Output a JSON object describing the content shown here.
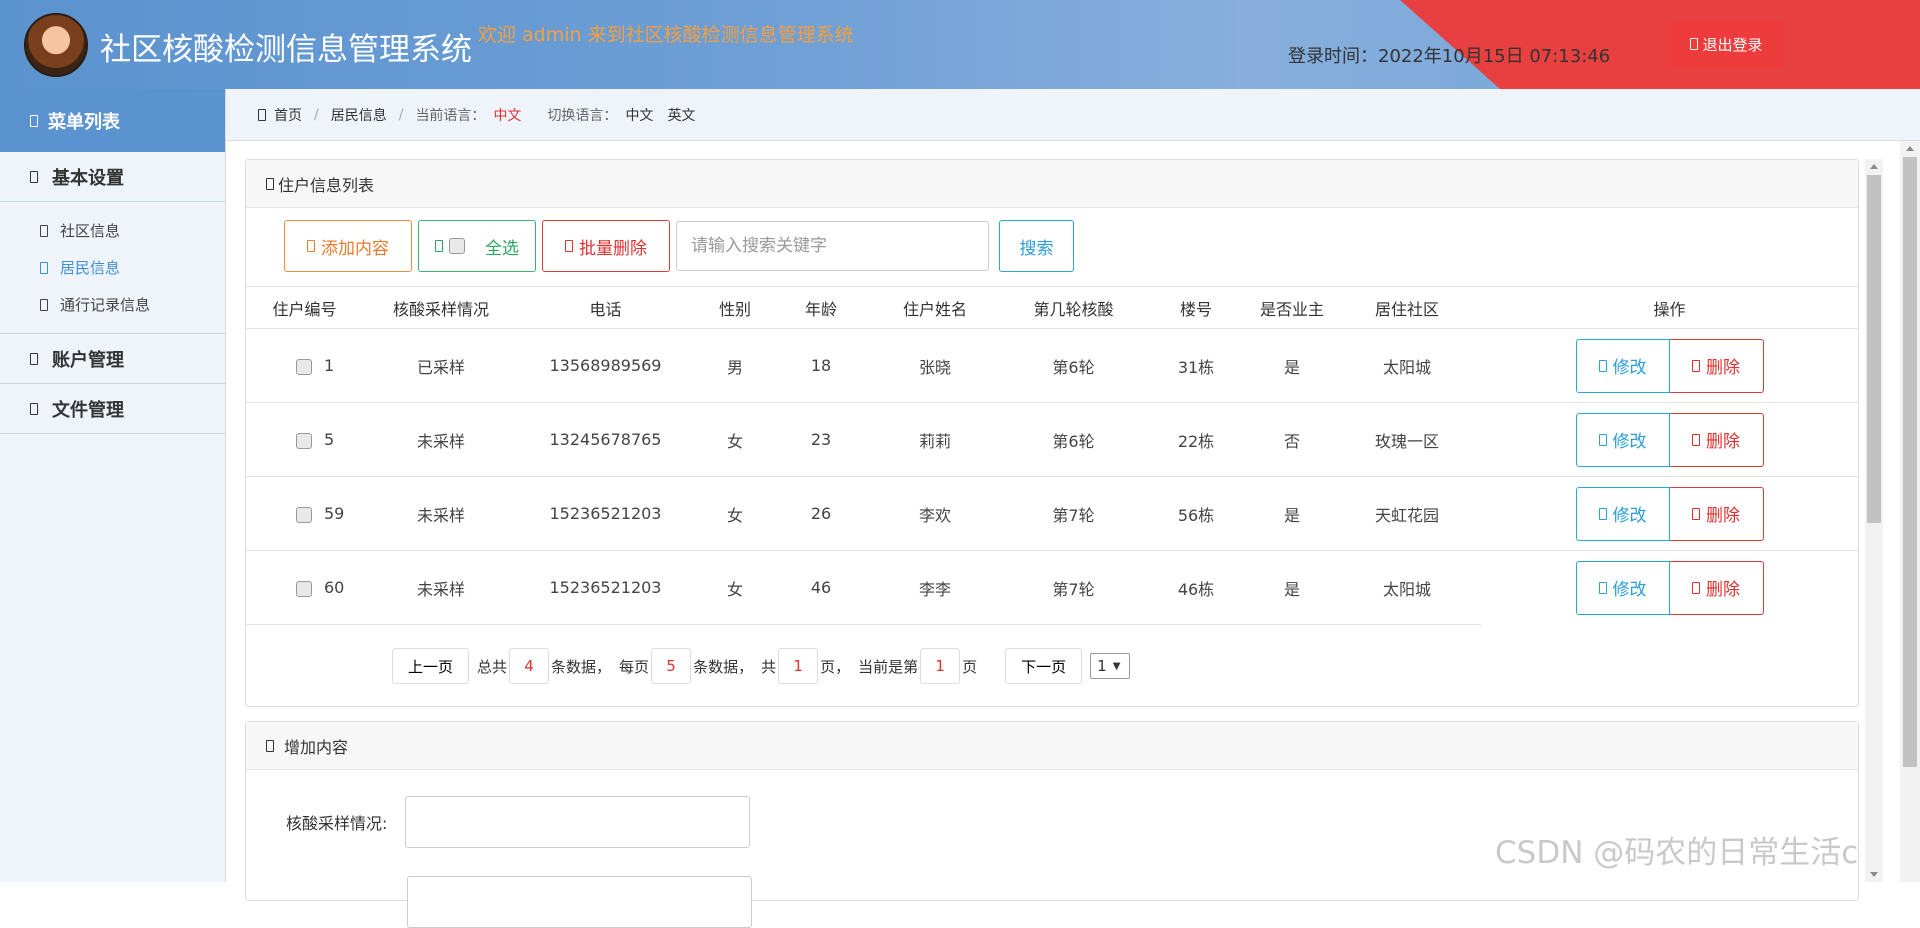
{
  "header": {
    "title": "社区核酸检测信息管理系统",
    "welcome": "欢迎 admin 来到社区核酸检测信息管理系统",
    "login_time_label": "登录时间：",
    "login_time": "2022年10月15日 07:13:46",
    "logout_label": "退出登录"
  },
  "sidebar": {
    "menu_title": "菜单列表",
    "groups": [
      {
        "label": "基本设置",
        "items": [
          {
            "label": "社区信息"
          },
          {
            "label": "居民信息"
          },
          {
            "label": "通行记录信息"
          }
        ]
      },
      {
        "label": "账户管理"
      },
      {
        "label": "文件管理"
      }
    ],
    "active_item": "居民信息"
  },
  "breadcrumb": {
    "home": "首页",
    "current": "居民信息",
    "lang_label": "当前语言：",
    "lang_value": "中文",
    "switch_label": "切换语言：",
    "lang_zh": "中文",
    "lang_en": "英文"
  },
  "list_panel": {
    "title": "住户信息列表",
    "add_label": "添加内容",
    "select_all_label": "全选",
    "batch_delete_label": "批量删除",
    "search_placeholder": "请输入搜索关键字",
    "search_label": "搜索"
  },
  "table": {
    "headers": [
      "住户编号",
      "核酸采样情况",
      "电话",
      "性别",
      "年龄",
      "住户姓名",
      "第几轮核酸",
      "楼号",
      "是否业主",
      "居住社区",
      "操作"
    ],
    "rows": [
      {
        "id": "1",
        "sample": "已采样",
        "phone": "13568989569",
        "gender": "男",
        "age": "18",
        "name": "张晓",
        "round": "第6轮",
        "building": "31栋",
        "owner": "是",
        "community": "太阳城"
      },
      {
        "id": "5",
        "sample": "未采样",
        "phone": "13245678765",
        "gender": "女",
        "age": "23",
        "name": "莉莉",
        "round": "第6轮",
        "building": "22栋",
        "owner": "否",
        "community": "玫瑰一区"
      },
      {
        "id": "59",
        "sample": "未采样",
        "phone": "15236521203",
        "gender": "女",
        "age": "26",
        "name": "李欢",
        "round": "第7轮",
        "building": "56栋",
        "owner": "是",
        "community": "天虹花园"
      },
      {
        "id": "60",
        "sample": "未采样",
        "phone": "15236521203",
        "gender": "女",
        "age": "46",
        "name": "李李",
        "round": "第7轮",
        "building": "46栋",
        "owner": "是",
        "community": "太阳城"
      }
    ],
    "edit_label": "修改",
    "delete_label": "删除"
  },
  "pager": {
    "prev": "上一页",
    "total_prefix": "总共",
    "total": "4",
    "total_suffix": "条数据，",
    "per_page_prefix": "每页",
    "per_page": "5",
    "per_page_suffix": "条数据，",
    "pages_prefix": "共",
    "pages": "1",
    "pages_suffix": "页，",
    "current_prefix": "当前是第",
    "current": "1",
    "current_suffix": "页",
    "next": "下一页",
    "select_value": "1"
  },
  "add_panel": {
    "title": "增加内容",
    "field_label": "核酸采样情况:"
  },
  "watermark": "CSDN @码农的日常生活c",
  "colors": {
    "header_blue": "#5b93cf",
    "header_red": "#e84040",
    "accent_red": "#e03030",
    "accent_blue": "#2a9fd8",
    "accent_green": "#2aa860",
    "accent_orange": "#f07a2c"
  }
}
